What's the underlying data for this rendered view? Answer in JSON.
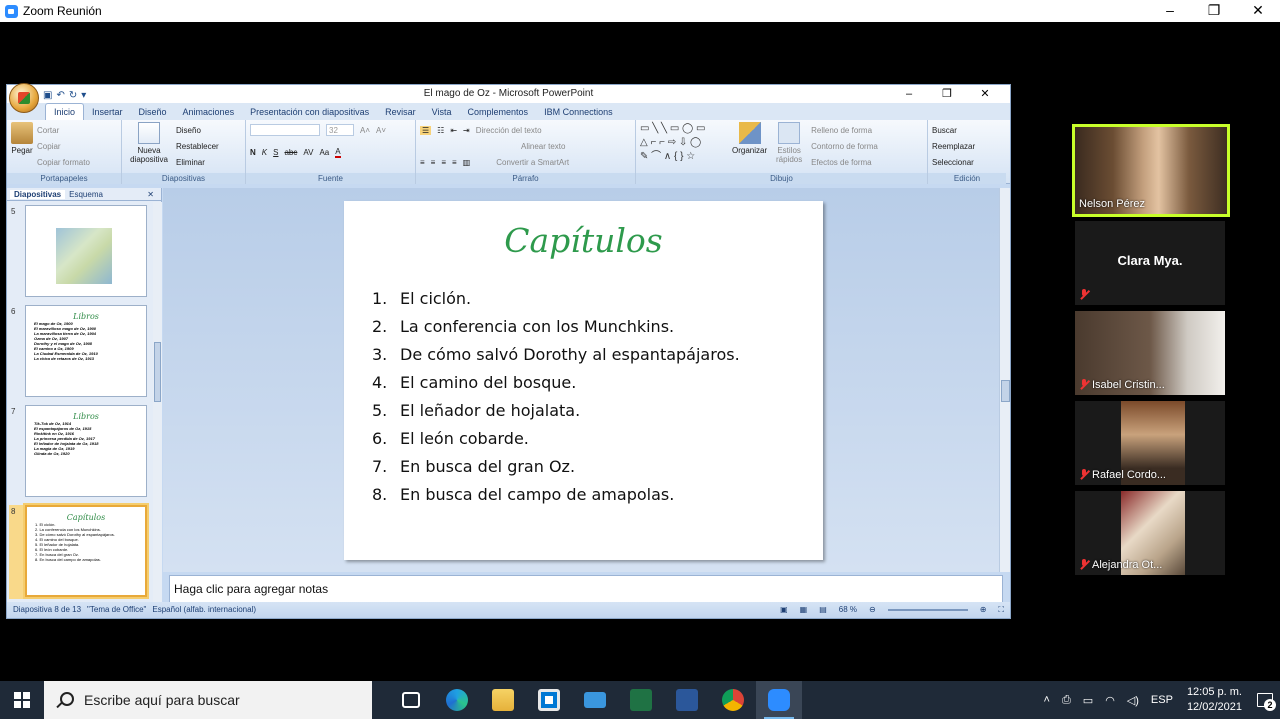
{
  "zoom": {
    "title": "Zoom Reunión",
    "controls": [
      "–",
      "❐",
      "✕"
    ]
  },
  "ppt": {
    "title": "El mago de Oz  -  Microsoft PowerPoint",
    "controls": [
      "–",
      "❐",
      "✕"
    ],
    "tabs": [
      "Inicio",
      "Insertar",
      "Diseño",
      "Animaciones",
      "Presentación con diapositivas",
      "Revisar",
      "Vista",
      "Complementos",
      "IBM Connections"
    ],
    "groups": {
      "portapapeles": {
        "label": "Portapapeles",
        "paste": "Pegar",
        "cut": "Cortar",
        "copy": "Copiar",
        "format": "Copiar formato"
      },
      "diapositivas": {
        "label": "Diapositivas",
        "new": "Nueva diapositiva",
        "layout": "Diseño",
        "reset": "Restablecer",
        "delete": "Eliminar"
      },
      "fuente": {
        "label": "Fuente",
        "size": "32"
      },
      "parrafo": {
        "label": "Párrafo",
        "dir": "Dirección del texto",
        "align": "Alinear texto",
        "smart": "Convertir a SmartArt"
      },
      "dibujo": {
        "label": "Dibujo",
        "arrange": "Organizar",
        "styles": "Estilos rápidos",
        "fill": "Relleno de forma",
        "outline": "Contorno de forma",
        "effects": "Efectos de forma"
      },
      "edicion": {
        "label": "Edición",
        "find": "Buscar",
        "replace": "Reemplazar",
        "select": "Seleccionar"
      }
    },
    "panel_tabs": [
      "Diapositivas",
      "Esquema"
    ],
    "thumbs": [
      {
        "num": "5"
      },
      {
        "num": "6",
        "title": "Libros",
        "lines": [
          "El mago de Oz, 1900",
          "El maravilloso mago de Oz, 1900",
          "La maravillosa tierra de Oz, 1904",
          "Ozma de Oz, 1907",
          "Dorothy y el mago de Oz, 1908",
          "El camino a Oz, 1909",
          "La Ciudad Esmeralda de Oz, 1910",
          "La chica de retazos de Oz, 1913"
        ]
      },
      {
        "num": "7",
        "title": "Libros",
        "lines": [
          "Tik-Tok de Oz, 1914",
          "El espantapájaros de Oz, 1915",
          "Rinkitink en Oz, 1916",
          "La princesa perdida de Oz, 1917",
          "El leñador de hojalata de Oz, 1918",
          "La magia de Oz, 1919",
          "Glinda de Oz, 1920"
        ]
      },
      {
        "num": "8",
        "title": "Capítulos",
        "lines": [
          "1. El ciclón.",
          "2. La conferencia con los Munchkins.",
          "3. De cómo salvó Dorothy al espantapájaros.",
          "4. El camino del bosque.",
          "5. El leñador de hojalata.",
          "6. El león cobarde.",
          "7. En busca del gran Oz.",
          "8. En busca del campo de amapolas."
        ]
      }
    ],
    "slide": {
      "title": "Capítulos",
      "items": [
        {
          "n": "1.",
          "text": "El ciclón."
        },
        {
          "n": "2.",
          "text": "La conferencia con los Munchkins."
        },
        {
          "n": "3.",
          "text": "De cómo salvó Dorothy al espantapájaros."
        },
        {
          "n": "4.",
          "text": "El camino del bosque."
        },
        {
          "n": "5.",
          "text": "El leñador de hojalata."
        },
        {
          "n": "6.",
          "text": "El león cobarde."
        },
        {
          "n": "7.",
          "text": "En busca del gran Oz."
        },
        {
          "n": "8.",
          "text": "En busca del campo de amapolas."
        }
      ]
    },
    "notes_placeholder": "Haga clic para agregar notas",
    "status": {
      "slide": "Diapositiva 8 de 13",
      "theme": "\"Tema de Office\"",
      "lang": "Español (alfab. internacional)",
      "zoom": "68 %"
    }
  },
  "participants": [
    {
      "name": "Nelson Pérez",
      "muted": false,
      "video": true
    },
    {
      "name": "Clara Mya.",
      "muted": true,
      "video": false
    },
    {
      "name": "Isabel Cristin...",
      "muted": true,
      "video": true
    },
    {
      "name": "Rafael Cordo...",
      "muted": true,
      "video": true
    },
    {
      "name": "Alejandra Ot...",
      "muted": true,
      "video": true
    }
  ],
  "taskbar": {
    "search_placeholder": "Escribe aquí para buscar",
    "lang": "ESP",
    "time": "12:05 p. m.",
    "date": "12/02/2021",
    "notifications": "2"
  },
  "colors": {
    "accent": "#2e9a4c",
    "zoom_active": "#c8ff2a",
    "taskbar": "#1f2a38"
  }
}
